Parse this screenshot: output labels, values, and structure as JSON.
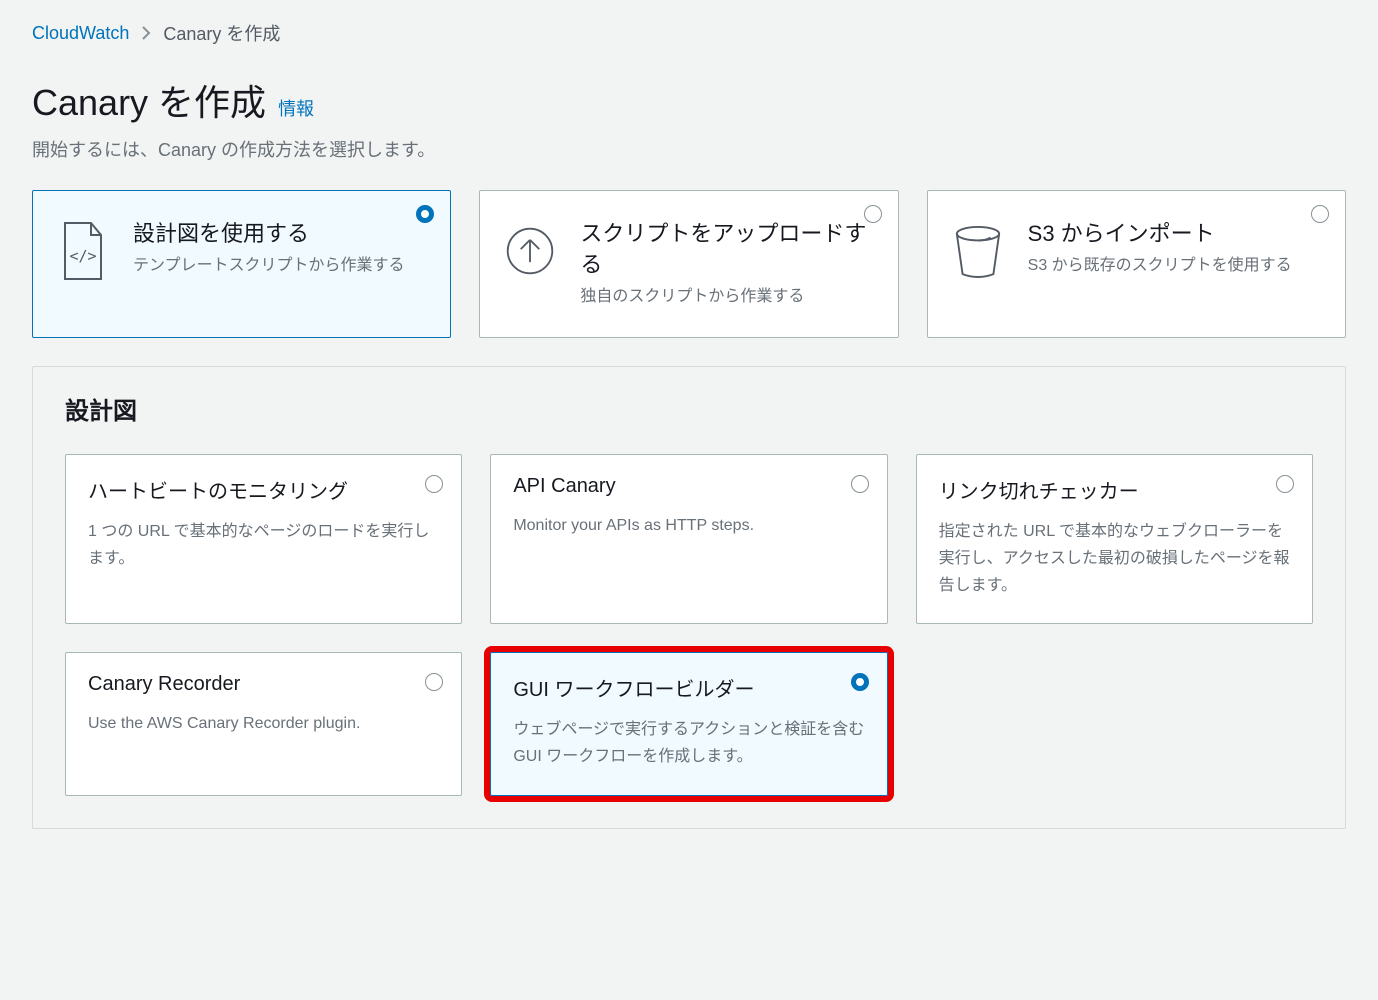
{
  "breadcrumb": {
    "root": "CloudWatch",
    "current": "Canary を作成"
  },
  "header": {
    "title": "Canary を作成",
    "info_label": "情報",
    "subtitle": "開始するには、Canary の作成方法を選択します。"
  },
  "methods": [
    {
      "id": "blueprint",
      "title": "設計図を使用する",
      "desc": "テンプレートスクリプトから作業する",
      "selected": true
    },
    {
      "id": "upload",
      "title": "スクリプトをアップロードする",
      "desc": "独自のスクリプトから作業する",
      "selected": false
    },
    {
      "id": "s3",
      "title": "S3 からインポート",
      "desc": "S3 から既存のスクリプトを使用する",
      "selected": false
    }
  ],
  "blueprints": {
    "section_title": "設計図",
    "items": [
      {
        "id": "heartbeat",
        "title": "ハートビートのモニタリング",
        "desc": "1 つの URL で基本的なページのロードを実行します。",
        "selected": false,
        "highlighted": false
      },
      {
        "id": "api",
        "title": "API Canary",
        "desc": "Monitor your APIs as HTTP steps.",
        "selected": false,
        "highlighted": false
      },
      {
        "id": "linkcheck",
        "title": "リンク切れチェッカー",
        "desc": "指定された URL で基本的なウェブクローラーを実行し、アクセスした最初の破損したページを報告します。",
        "selected": false,
        "highlighted": false
      },
      {
        "id": "recorder",
        "title": "Canary Recorder",
        "desc": "Use the AWS Canary Recorder plugin.",
        "selected": false,
        "highlighted": false
      },
      {
        "id": "gui",
        "title": "GUI ワークフロービルダー",
        "desc": "ウェブページで実行するアクションと検証を含む GUI ワークフローを作成します。",
        "selected": true,
        "highlighted": true
      }
    ]
  }
}
